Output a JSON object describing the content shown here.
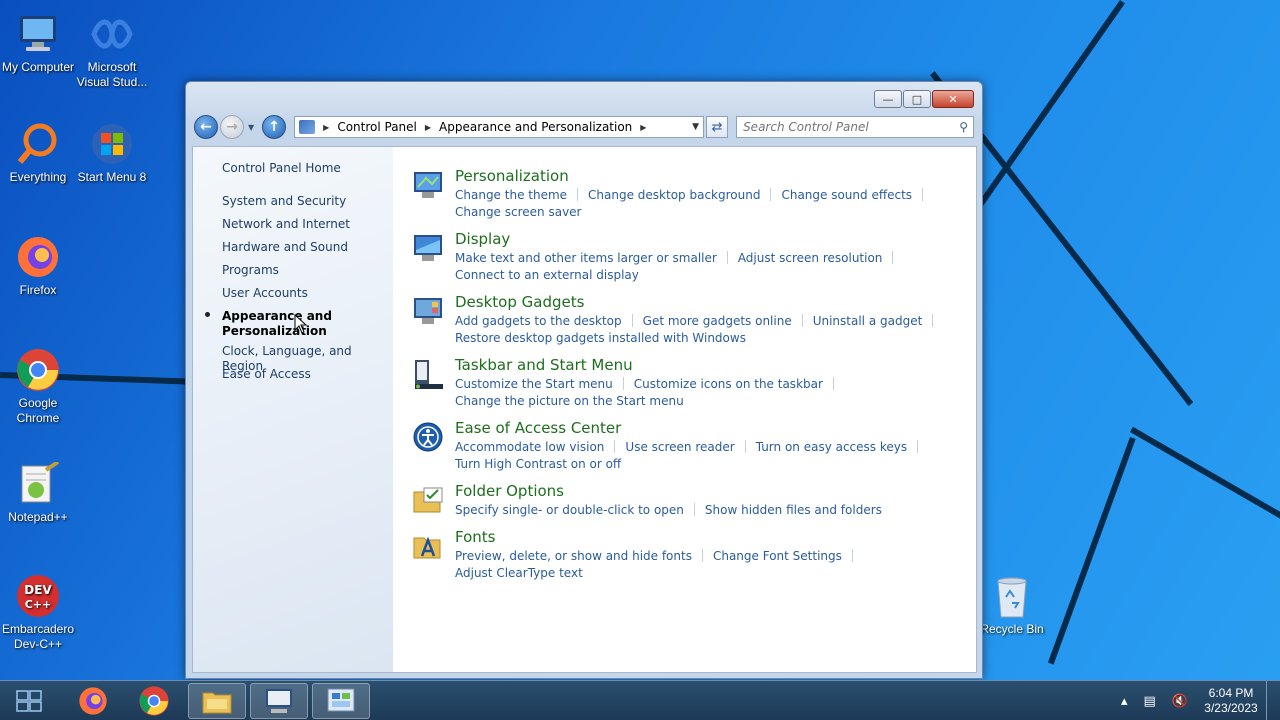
{
  "desktop": {
    "icons": [
      {
        "label": "My Computer",
        "icon": "computer-icon"
      },
      {
        "label": "Microsoft Visual Stud...",
        "icon": "visual-studio-icon"
      },
      {
        "label": "Everything",
        "icon": "everything-search-icon"
      },
      {
        "label": "Start Menu 8",
        "icon": "start-menu-icon"
      },
      {
        "label": "Firefox",
        "icon": "firefox-icon"
      },
      {
        "label": "Google Chrome",
        "icon": "chrome-icon"
      },
      {
        "label": "Notepad++",
        "icon": "notepad-plus-plus-icon"
      },
      {
        "label": "Embarcadero Dev-C++",
        "icon": "devcpp-icon"
      },
      {
        "label": "Recycle Bin",
        "icon": "recycle-bin-icon"
      }
    ]
  },
  "window": {
    "address": {
      "crumbs": [
        "Control Panel",
        "Appearance and Personalization"
      ]
    },
    "search_placeholder": "Search Control Panel",
    "sidebar": {
      "items": [
        "Control Panel Home",
        "System and Security",
        "Network and Internet",
        "Hardware and Sound",
        "Programs",
        "User Accounts",
        "Appearance and Personalization",
        "Clock, Language, and Region",
        "Ease of Access"
      ],
      "active_index": 6
    },
    "categories": [
      {
        "title": "Personalization",
        "icon": "personalization-icon",
        "links": [
          "Change the theme",
          "Change desktop background",
          "Change sound effects",
          "Change screen saver"
        ]
      },
      {
        "title": "Display",
        "icon": "display-icon",
        "links": [
          "Make text and other items larger or smaller",
          "Adjust screen resolution",
          "Connect to an external display"
        ]
      },
      {
        "title": "Desktop Gadgets",
        "icon": "gadgets-icon",
        "links": [
          "Add gadgets to the desktop",
          "Get more gadgets online",
          "Uninstall a gadget",
          "Restore desktop gadgets installed with Windows"
        ]
      },
      {
        "title": "Taskbar and Start Menu",
        "icon": "taskbar-icon",
        "links": [
          "Customize the Start menu",
          "Customize icons on the taskbar",
          "Change the picture on the Start menu"
        ]
      },
      {
        "title": "Ease of Access Center",
        "icon": "ease-of-access-icon",
        "links": [
          "Accommodate low vision",
          "Use screen reader",
          "Turn on easy access keys",
          "Turn High Contrast on or off"
        ]
      },
      {
        "title": "Folder Options",
        "icon": "folder-options-icon",
        "links": [
          "Specify single- or double-click to open",
          "Show hidden files and folders"
        ]
      },
      {
        "title": "Fonts",
        "icon": "fonts-icon",
        "links": [
          "Preview, delete, or show and hide fonts",
          "Change Font Settings",
          "Adjust ClearType text"
        ]
      }
    ]
  },
  "taskbar": {
    "time": "6:04 PM",
    "date": "3/23/2023",
    "apps": [
      "start-icon",
      "firefox-icon",
      "chrome-icon",
      "file-explorer-icon",
      "remote-desktop-icon",
      "control-panel-icon"
    ]
  },
  "colors": {
    "category_title": "#1e6e1e",
    "link": "#2b5c9a",
    "sidebar_text": "#1e3e66"
  }
}
